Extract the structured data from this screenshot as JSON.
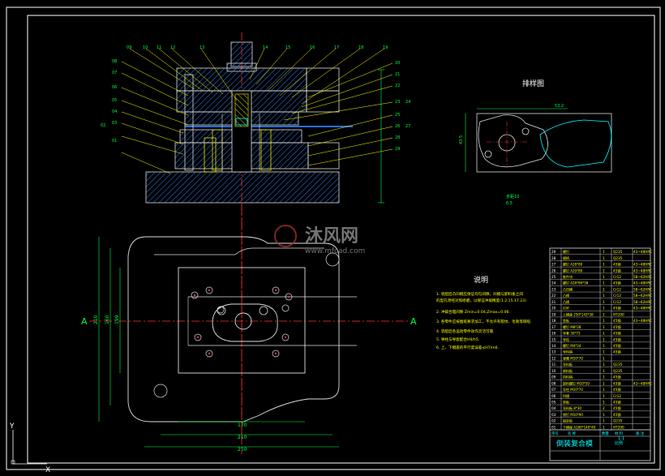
{
  "watermark": {
    "cn": "沐风网",
    "url": "www.mfcad.com"
  },
  "section_marks": {
    "left": "A",
    "right": "A"
  },
  "layout_title": "排样图",
  "layout_dims": {
    "width": "53.2",
    "height": "43.5",
    "note1": "步距10",
    "note2": "6.5"
  },
  "notes": {
    "title": "说明",
    "lines": [
      "1. 装配后凸凹模应保证均匀间隙，凹模与卸料板之间",
      "   的型孔须经对照修磨，以保证冲裁精度(1.2.15.17.23)",
      "2. 冲裁合理间隙 Zmin=0.04,Zmax=0.06.",
      "3. 各零件应按图纸要求加工，不允许有裂纹、毛刺等缺陷",
      "4. 装配后各运动零件动作灵活可靠.",
      "5. 导柱与导套配合H6/h5.",
      "6. 上、下模座的平行度误差≤H7/m6."
    ]
  },
  "dimensions": {
    "d170": "170",
    "d210": "210",
    "d250": "250",
    "dv1": "210",
    "dv2": "160",
    "dv3": "199"
  },
  "callouts_left": [
    "08",
    "07",
    "06",
    "05",
    "04",
    "03",
    "02",
    "01"
  ],
  "callouts_top": [
    "09",
    "10",
    "11",
    "12",
    "13",
    "14",
    "15",
    "16",
    "17",
    "18",
    "19"
  ],
  "callouts_right": [
    "20",
    "21",
    "22",
    "23",
    "24",
    "25",
    "26",
    "27",
    "28",
    "29"
  ],
  "bom": {
    "rows": [
      [
        "29",
        "螺钉",
        "1",
        "Q235",
        "43~48HRC"
      ],
      [
        "28",
        "模柄",
        "1",
        "Q235",
        ""
      ],
      [
        "27",
        "螺钉 A28*80",
        "1",
        "45钢",
        "43~48HRC"
      ],
      [
        "26",
        "螺钉 A20*80",
        "1",
        "45钢",
        "43~48HRC"
      ],
      [
        "25",
        "推件块",
        "1",
        "Cr12",
        "58~62HRC"
      ],
      [
        "24",
        "螺钉 A28*80*38",
        "1",
        "45钢",
        "43~48HRC"
      ],
      [
        "23",
        "凸凹模",
        "1",
        "Cr12",
        "58~62HRC"
      ],
      [
        "22",
        "凸模",
        "1",
        "Cr12",
        "58~62HRC"
      ],
      [
        "21",
        "凸模",
        "1",
        "Cr12",
        "58~62HRC"
      ],
      [
        "20",
        "打杆",
        "1",
        "45钢",
        "43~48HRC"
      ],
      [
        "19",
        "上模座 250*143*38",
        "1",
        "HT200",
        ""
      ],
      [
        "18",
        "垫板",
        "1",
        "45钢",
        "43~48HRC"
      ],
      [
        "17",
        "螺钉 M8*28",
        "1",
        "45钢",
        ""
      ],
      [
        "16",
        "导套 30*73",
        "1",
        "45钢",
        ""
      ],
      [
        "15",
        "导柱",
        "1",
        "45钢",
        ""
      ],
      [
        "14",
        "螺钉 M4*24",
        "1",
        "45钢",
        ""
      ],
      [
        "13",
        "导料销",
        "1",
        "45钢",
        ""
      ],
      [
        "12",
        "弹簧 M10*70",
        "1",
        "",
        ""
      ],
      [
        "11",
        "导料板",
        "1",
        "Q235",
        ""
      ],
      [
        "10",
        "卸料板",
        "1",
        "Q235",
        ""
      ],
      [
        "09",
        "挡料销",
        "1",
        "45钢",
        ""
      ],
      [
        "08",
        "卸料螺钉 M10*50",
        "1",
        "45钢",
        "43~48HRC"
      ],
      [
        "07",
        "导柱 M10*70",
        "1",
        "45钢",
        ""
      ],
      [
        "06",
        "凹模",
        "1",
        "Cr12",
        ""
      ],
      [
        "05",
        "垫板",
        "1",
        "45钢",
        ""
      ],
      [
        "04",
        "导料板 8*30",
        "2",
        "45钢",
        ""
      ],
      [
        "03",
        "销钉 M10*90",
        "1",
        "45钢",
        ""
      ],
      [
        "02",
        "固定板",
        "1",
        "Q235",
        ""
      ],
      [
        "01",
        "下模座 A180*140*40",
        "1",
        "HT200",
        ""
      ]
    ],
    "header": [
      "序号",
      "名 称",
      "数量",
      "材 料",
      "备 注"
    ],
    "title": "倒装复合模",
    "scale": "1:1",
    "scale_label": "比例"
  },
  "ucs": {
    "y": "Y",
    "x": "X"
  }
}
